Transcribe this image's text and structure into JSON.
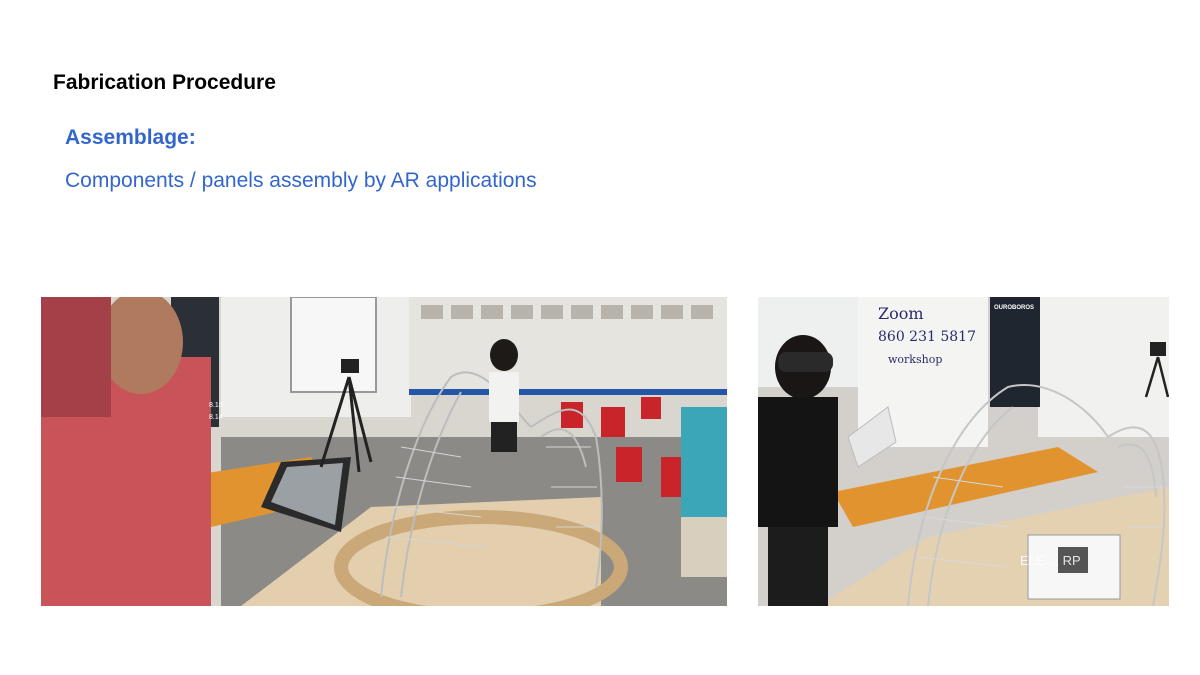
{
  "slide": {
    "title": "Fabrication Procedure",
    "subtitle": "Assemblage:",
    "description": "Components / panels assembly by AR applications"
  },
  "colors": {
    "title": "#000000",
    "accent_blue": "#3366cc"
  },
  "photos": {
    "left": {
      "kind": "photograph",
      "whiteboard_text": [
        "8.10",
        "8.14"
      ]
    },
    "right": {
      "kind": "photograph",
      "whiteboard_text": [
        "Zoom",
        "860 231 5817",
        "workshop",
        "OUROBOROS"
      ],
      "overlay_text": "ELE ... RP"
    }
  }
}
